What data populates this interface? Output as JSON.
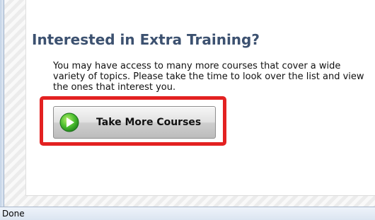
{
  "main": {
    "heading": "Interested in Extra Training?",
    "description": "You may have access to many more courses that cover a wide variety of topics. Please take the time to look over the list and view the ones that interest you.",
    "button": {
      "label": "Take More Courses",
      "icon": "play-icon",
      "icon_color": "#3aa935"
    },
    "highlight_color": "#e32121",
    "heading_color": "#3c5170"
  },
  "status_bar": {
    "text": "Done"
  }
}
